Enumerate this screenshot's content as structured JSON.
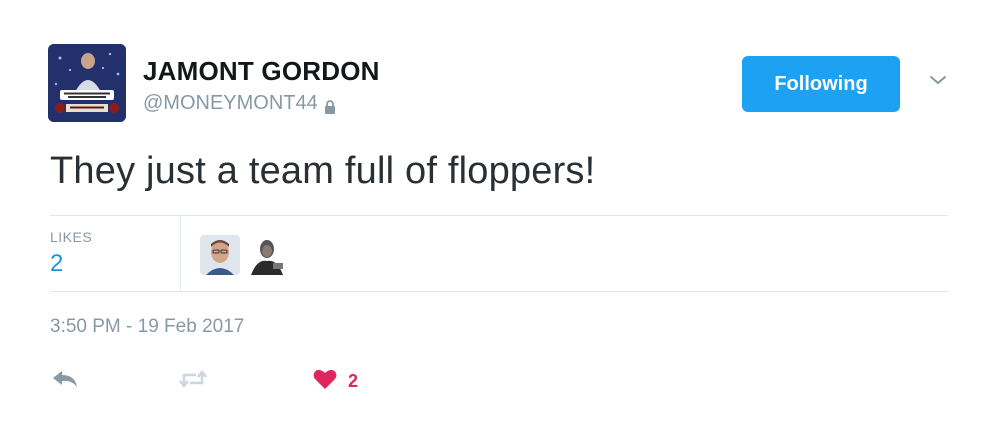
{
  "author": {
    "display_name": "JAMONT GORDON",
    "handle": "@MONEYMONT44",
    "protected_icon": "lock-icon",
    "avatar_icon": "profile-avatar"
  },
  "follow_button": {
    "label": "Following",
    "color": "#1da1f2"
  },
  "menu_icon": "chevron-down-icon",
  "tweet": {
    "text": "They just a team full of floppers!"
  },
  "stats": {
    "likes_label": "LIKES",
    "likes_count": "2",
    "likers": [
      "liker-avatar-1",
      "liker-avatar-2"
    ]
  },
  "timestamp": "3:50 PM - 19 Feb 2017",
  "actions": {
    "reply_icon": "reply-icon",
    "retweet_icon": "retweet-icon",
    "like_icon": "heart-icon",
    "like_count": "2",
    "like_color": "#e0245e",
    "accent_color": "#1b95e0"
  }
}
